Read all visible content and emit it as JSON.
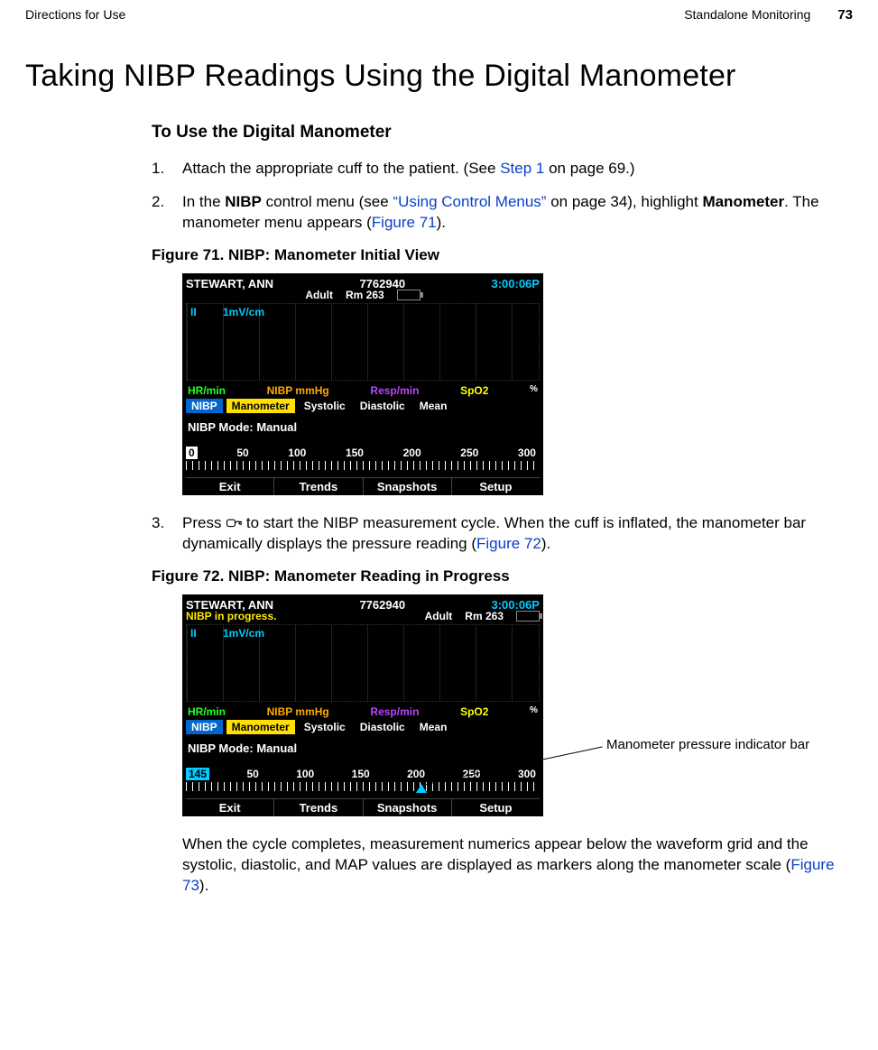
{
  "header": {
    "left": "Directions for Use",
    "section": "Standalone Monitoring",
    "page_no": "73"
  },
  "title": "Taking NIBP Readings Using the Digital Manometer",
  "subhead": "To Use the Digital Manometer",
  "steps": {
    "s1_pre": "Attach the appropriate cuff to the patient. (See ",
    "s1_link": "Step 1",
    "s1_post": " on page 69.)",
    "s2_a": "In the ",
    "s2_nibp": "NIBP",
    "s2_b": " control menu (see ",
    "s2_link": "“Using Control Menus”",
    "s2_c": " on page 34), highlight ",
    "s2_mano": "Manometer",
    "s2_d": ". The manometer menu appears (",
    "s2_fig": "Figure 71",
    "s2_e": ").",
    "s3_a": "Press ",
    "s3_b": " to start the NIBP measurement cycle. When the cuff is inflated, the manometer bar dynamically displays the pressure reading (",
    "s3_fig": "Figure 72",
    "s3_c": ")."
  },
  "fig71_cap": "Figure 71.  NIBP: Manometer Initial View",
  "fig72_cap": "Figure 72.  NIBP: Manometer Reading in Progress",
  "callout": "Manometer pressure indicator bar",
  "trailing": {
    "a": "When the cycle completes, measurement numerics appear below the waveform grid and the systolic, diastolic, and MAP values are displayed as markers along the manometer scale (",
    "link": "Figure 73",
    "b": ")."
  },
  "screen_common": {
    "patient": "STEWART, ANN",
    "id": "7762940",
    "time": "3:00:06P",
    "mode": "Adult",
    "room": "Rm 263",
    "lead": "II",
    "gain": "1mV/cm",
    "params": {
      "hr": "HR/min",
      "nibp": "NIBP mmHg",
      "resp": "Resp/min",
      "spo2": "SpO2",
      "pct": "%"
    },
    "tabs": {
      "nibp": "NIBP",
      "mano": "Manometer",
      "sys": "Systolic",
      "dia": "Diastolic",
      "mean": "Mean"
    },
    "mode_line": "NIBP Mode:  Manual",
    "scale": [
      "50",
      "100",
      "150",
      "200",
      "250",
      "300"
    ],
    "softkeys": [
      "Exit",
      "Trends",
      "Snapshots",
      "Setup"
    ]
  },
  "screen71": {
    "value": "0",
    "msg": ""
  },
  "screen72": {
    "value": "145",
    "msg": "NIBP in progress."
  },
  "chart_data": [
    {
      "type": "bar",
      "title": "NIBP Manometer Initial View",
      "xlabel": "mmHg",
      "ylabel": "",
      "x_range": [
        0,
        300
      ],
      "ticks": [
        0,
        50,
        100,
        150,
        200,
        250,
        300
      ],
      "value": 0
    },
    {
      "type": "bar",
      "title": "NIBP Manometer Reading in Progress",
      "xlabel": "mmHg",
      "ylabel": "",
      "x_range": [
        0,
        300
      ],
      "ticks": [
        0,
        50,
        100,
        150,
        200,
        250,
        300
      ],
      "value": 145,
      "marker_approx_mmHg": 200
    }
  ]
}
